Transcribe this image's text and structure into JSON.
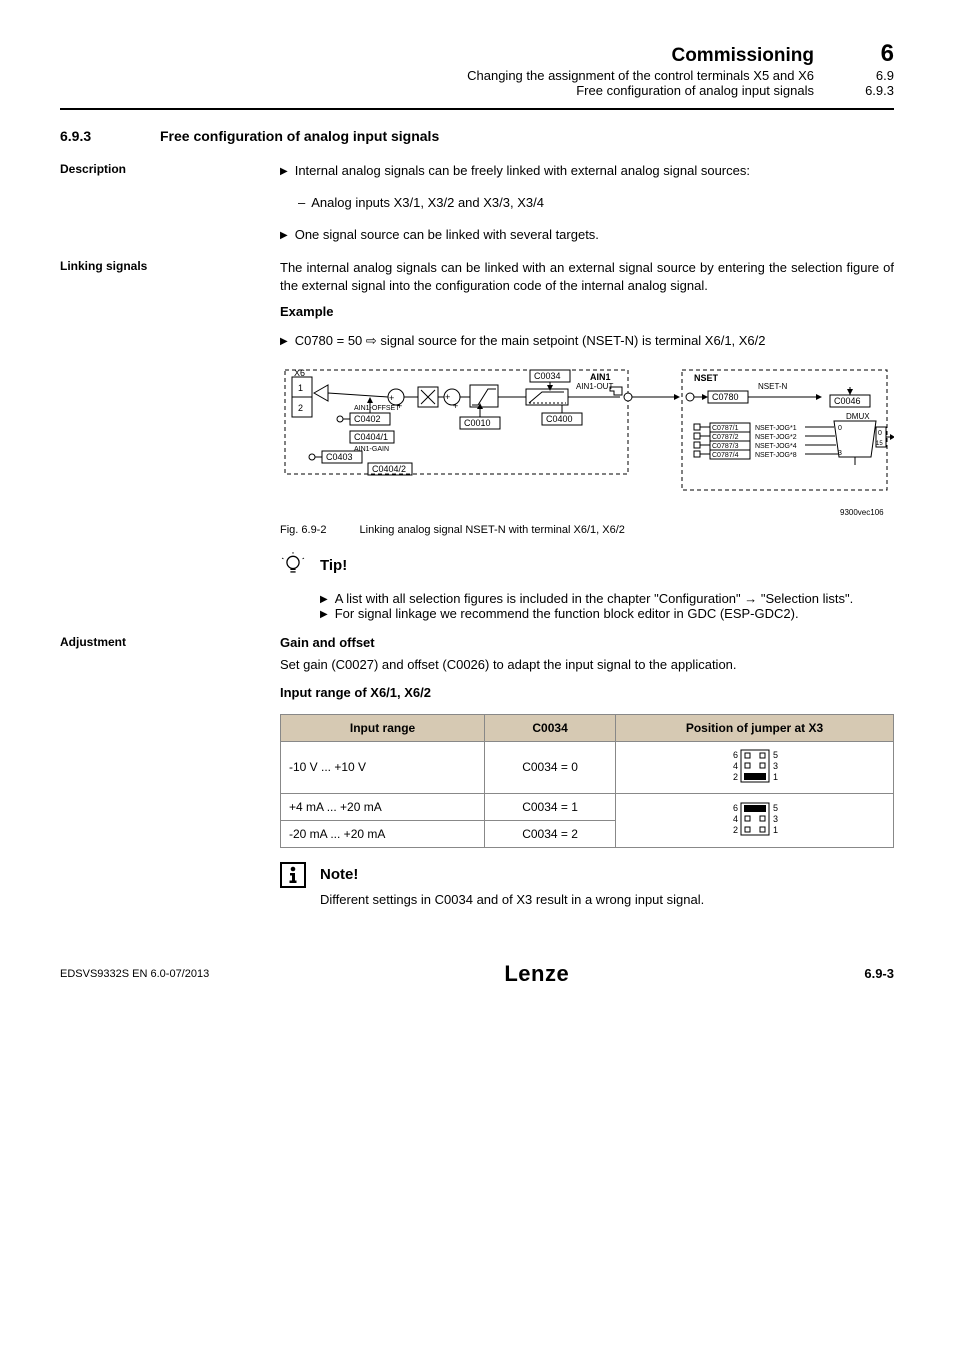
{
  "header": {
    "title": "Commissioning",
    "chapnum": "6",
    "sub1": "Changing the assignment of the control terminals X5 and X6",
    "sub1num": "6.9",
    "sub2": "Free configuration of analog input signals",
    "sub2num": "6.9.3"
  },
  "section": {
    "num": "6.9.3",
    "title": "Free configuration of analog input signals"
  },
  "labels": {
    "description": "Description",
    "linking": "Linking signals",
    "adjustment": "Adjustment"
  },
  "description": {
    "b1": "Internal analog signals can be freely linked with external analog signal sources:",
    "b1a": "Analog inputs X3/1, X3/2 and X3/3, X3/4",
    "b2": "One signal source can be linked with several targets."
  },
  "linking": {
    "p1": "The internal analog signals can be linked with an external signal source by entering the selection figure of the external signal into the configuration code of the internal analog signal.",
    "exh": "Example",
    "ex1": "C0780 = 50 ⇨ signal source for the main setpoint (NSET-N) is terminal X6/1, X6/2"
  },
  "fig": {
    "num": "Fig. 6.9-2",
    "cap": "Linking analog signal NSET-N with terminal X6/1, X6/2",
    "id": "9300vec106",
    "text": {
      "x6": "X6",
      "ain1": "AIN1",
      "ain1out": "AIN1-OUT",
      "c0034": "C0034",
      "c0400": "C0400",
      "c0010": "C0010",
      "c0402": "C0402",
      "c0403": "C0403",
      "c04041": "C0404/1",
      "c04042": "C0404/2",
      "ain1off": "AIN1-OFFSET",
      "ain1gain": "AIN1-GAIN",
      "nset": "NSET",
      "nsetn": "NSET-N",
      "c0780": "C0780",
      "c0046": "C0046",
      "dmux": "DMUX",
      "zerofifteen0": "0",
      "zerofifteen15": "15",
      "j1": "NSET-JOG*1",
      "j2": "NSET-JOG*2",
      "j3": "NSET-JOG*4",
      "j4": "NSET-JOG*8",
      "c07871": "C0787/1",
      "c07872": "C0787/2",
      "c07873": "C0787/3",
      "c07874": "C0787/4",
      "n0": "0",
      "n3": "3"
    }
  },
  "tip": {
    "head": "Tip!",
    "b1": "A list with all selection figures is included in the chapter \"Configuration\" → \"Selection lists\".",
    "b2": "For signal linkage we recommend the function block editor in GDC (ESP-GDC2)."
  },
  "adjustment": {
    "h1": "Gain and offset",
    "p1": "Set gain (C0027) and offset (C0026) to adapt the input signal to the application.",
    "h2": "Input range of X6/1, X6/2",
    "th1": "Input range",
    "th2": "C0034",
    "th3": "Position of jumper at X3",
    "r1c1": "-10 V ... +10 V",
    "r1c2": "C0034 = 0",
    "r2c1": "+4 mA ... +20 mA",
    "r2c2": "C0034 = 1",
    "r3c1": "-20 mA ... +20 mA",
    "r3c2": "C0034 = 2"
  },
  "note": {
    "head": "Note!",
    "p1": "Different settings in C0034 and of X3 result in a wrong input signal."
  },
  "footer": {
    "left": "EDSVS9332S EN 6.0-07/2013",
    "logo": "Lenze",
    "page": "6.9-3"
  },
  "jumper_labels": {
    "l6": "6",
    "l5": "5",
    "l4": "4",
    "l3": "3",
    "l2": "2",
    "l1": "1"
  }
}
